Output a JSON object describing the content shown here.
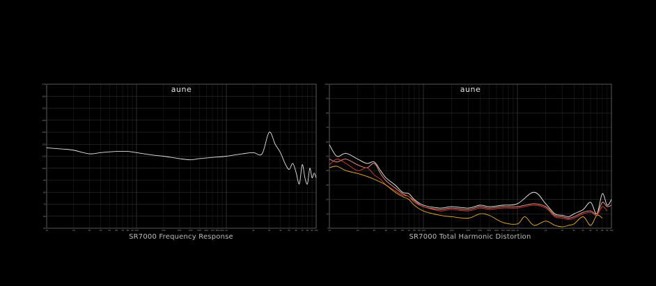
{
  "colors": {
    "background": "#000000",
    "grid_major": "#3a3a3a",
    "grid_minor": "#1f1f1f",
    "frame": "#6a6a6a",
    "text": "#bdbdbd",
    "fr_line": "#e6e6e6",
    "thd_white": "#f2f2f2",
    "thd_salmon": "#ff9e8a",
    "thd_red": "#e0403a",
    "thd_orange": "#f2b22a"
  },
  "chart_data": [
    {
      "id": "fr",
      "type": "line",
      "title": "SR7000 Frequency Response",
      "logo": "aune",
      "x_scale": "log",
      "xlim": [
        10,
        10000
      ],
      "ylim": [
        50,
        170
      ],
      "x_major_ticks": [
        10,
        100,
        1000,
        10000
      ],
      "x_minor_ticks": [
        20,
        30,
        40,
        50,
        60,
        70,
        80,
        90,
        200,
        300,
        400,
        500,
        600,
        700,
        800,
        900,
        2000,
        3000,
        4000,
        5000,
        6000,
        7000,
        8000,
        9000
      ],
      "y_ticks": [
        50,
        60,
        70,
        80,
        90,
        100,
        110,
        120,
        130,
        140,
        150,
        160,
        170
      ],
      "series": [
        {
          "color_key": "fr_line",
          "x": [
            10,
            15,
            20,
            30,
            40,
            60,
            80,
            100,
            150,
            200,
            300,
            400,
            500,
            700,
            1000,
            1500,
            2000,
            2500,
            3000,
            3500,
            4000,
            4500,
            5000,
            5500,
            6000,
            6500,
            7000,
            7500,
            8000,
            8500,
            9000,
            9500,
            10000
          ],
          "y": [
            117,
            116,
            115,
            112,
            113,
            114,
            114,
            113,
            111,
            110,
            108,
            107,
            108,
            109,
            110,
            112,
            113,
            112,
            130,
            120,
            113,
            104,
            99,
            104,
            96,
            87,
            103,
            92,
            87,
            100,
            92,
            96,
            92
          ]
        }
      ]
    },
    {
      "id": "thd",
      "type": "line",
      "title": "SR7000 Total Harmonic Distortion",
      "logo": "aune",
      "x_scale": "log",
      "xlim": [
        10,
        10000
      ],
      "ylim": [
        0,
        100
      ],
      "x_major_ticks": [
        10,
        100,
        1000,
        10000
      ],
      "x_minor_ticks": [
        20,
        30,
        40,
        50,
        60,
        70,
        80,
        90,
        200,
        300,
        400,
        500,
        600,
        700,
        800,
        900,
        2000,
        3000,
        4000,
        5000,
        6000,
        7000,
        8000,
        9000
      ],
      "y_ticks": [
        0,
        10,
        20,
        30,
        40,
        50,
        60,
        70,
        80,
        90,
        100
      ],
      "series": [
        {
          "color_key": "thd_white",
          "x": [
            10,
            12,
            15,
            20,
            25,
            30,
            35,
            40,
            50,
            60,
            70,
            80,
            100,
            150,
            200,
            300,
            400,
            500,
            700,
            1000,
            1500,
            2000,
            2500,
            3000,
            3500,
            4000,
            5000,
            6000,
            7000,
            8000,
            9000,
            10000
          ],
          "y": [
            58,
            50,
            52,
            48,
            45,
            46,
            40,
            35,
            30,
            25,
            24,
            20,
            16,
            14,
            15,
            14,
            16,
            15,
            16,
            17,
            25,
            17,
            10,
            9,
            8,
            10,
            13,
            18,
            10,
            24,
            16,
            20
          ]
        },
        {
          "color_key": "thd_salmon",
          "x": [
            10,
            12,
            15,
            20,
            25,
            30,
            35,
            40,
            50,
            60,
            70,
            80,
            100,
            150,
            200,
            300,
            400,
            500,
            700,
            1000,
            1500,
            2000,
            2500,
            3000,
            3500,
            4000,
            5000,
            6000,
            7000,
            8000,
            9000,
            10000
          ],
          "y": [
            48,
            46,
            48,
            44,
            42,
            45,
            38,
            33,
            28,
            24,
            22,
            19,
            15,
            13,
            14,
            13,
            15,
            14,
            15,
            15,
            17,
            15,
            9,
            8,
            7,
            8,
            11,
            12,
            10,
            18,
            15,
            16
          ]
        },
        {
          "color_key": "thd_red",
          "x": [
            10,
            12,
            15,
            20,
            25,
            30,
            35,
            40,
            50,
            60,
            70,
            80,
            100,
            150,
            200,
            300,
            400,
            500,
            700,
            1000,
            1500,
            2000,
            2500,
            3000,
            3500,
            4000,
            5000,
            6000,
            7000,
            8000,
            9000
          ],
          "y": [
            44,
            48,
            45,
            40,
            42,
            37,
            34,
            30,
            26,
            23,
            22,
            18,
            15,
            12,
            13,
            12,
            14,
            13,
            14,
            14,
            16,
            14,
            8,
            7,
            6,
            7,
            10,
            11,
            9,
            15,
            12
          ]
        },
        {
          "color_key": "thd_orange",
          "x": [
            10,
            12,
            15,
            20,
            25,
            30,
            35,
            40,
            50,
            60,
            70,
            80,
            100,
            150,
            200,
            300,
            400,
            500,
            700,
            1000,
            1200,
            1500,
            2000,
            2500,
            3000,
            3500,
            4000,
            5000,
            6000,
            7000,
            8000
          ],
          "y": [
            42,
            43,
            40,
            38,
            36,
            34,
            32,
            30,
            25,
            22,
            20,
            16,
            12,
            9,
            8,
            7,
            10,
            9,
            4,
            3,
            8,
            2,
            5,
            2,
            1,
            2,
            3,
            8,
            2,
            9,
            7
          ]
        }
      ]
    }
  ]
}
